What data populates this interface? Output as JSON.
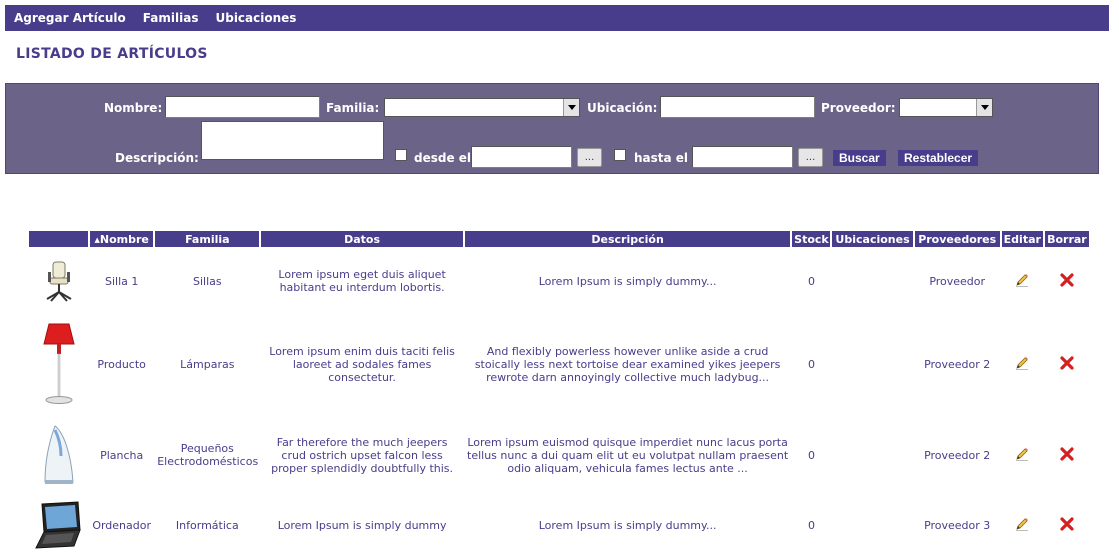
{
  "nav": {
    "items": [
      {
        "label": "Agregar Artículo"
      },
      {
        "label": "Familias"
      },
      {
        "label": "Ubicaciones"
      }
    ]
  },
  "page_title": "LISTADO DE ARTÍCULOS",
  "filters": {
    "nombre_label": "Nombre:",
    "familia_label": "Familia:",
    "ubicacion_label": "Ubicación:",
    "proveedor_label": "Proveedor:",
    "descripcion_label": "Descripción:",
    "desde_label": "desde el",
    "hasta_label": "hasta el",
    "dots": "...",
    "buscar": "Buscar",
    "restablecer": "Restablecer"
  },
  "table": {
    "headers": [
      "",
      "Nombre",
      "Familia",
      "Datos",
      "Descripción",
      "Stock",
      "Ubicaciones",
      "Proveedores",
      "Editar",
      "Borrar"
    ],
    "sort_indicator": "▲",
    "rows": [
      {
        "image": "chair-image",
        "nombre": "Silla 1",
        "familia": "Sillas",
        "datos": "Lorem ipsum eget duis aliquet habitant eu interdum lobortis.",
        "descripcion": "Lorem Ipsum is simply dummy...",
        "stock": "0",
        "ubicaciones": "",
        "proveedores": "Proveedor"
      },
      {
        "image": "lamp-image",
        "nombre": "Producto",
        "familia": "Lámparas",
        "datos": "Lorem ipsum enim duis taciti felis laoreet ad sodales fames consectetur.",
        "descripcion": "And flexibly powerless however unlike aside a crud stoically less next tortoise dear examined yikes jeepers rewrote darn annoyingly collective much ladybug...",
        "stock": "0",
        "ubicaciones": "",
        "proveedores": "Proveedor 2"
      },
      {
        "image": "iron-image",
        "nombre": "Plancha",
        "familia": "Pequeños Electrodomésticos",
        "datos": "Far therefore the much jeepers crud ostrich upset falcon less proper splendidly doubtfully this.",
        "descripcion": "Lorem ipsum euismod quisque imperdiet nunc lacus porta tellus nunc a dui quam elit ut eu volutpat nullam praesent odio aliquam, vehicula fames lectus ante ...",
        "stock": "0",
        "ubicaciones": "",
        "proveedores": "Proveedor 2"
      },
      {
        "image": "laptop-image",
        "nombre": "Ordenador",
        "familia": "Informática",
        "datos": "Lorem Ipsum is simply dummy",
        "descripcion": "Lorem Ipsum is simply dummy...",
        "stock": "0",
        "ubicaciones": "",
        "proveedores": "Proveedor 3"
      }
    ]
  },
  "colors": {
    "primary": "#483d8b",
    "panel": "#6b6488",
    "stock": "#cc0000"
  }
}
